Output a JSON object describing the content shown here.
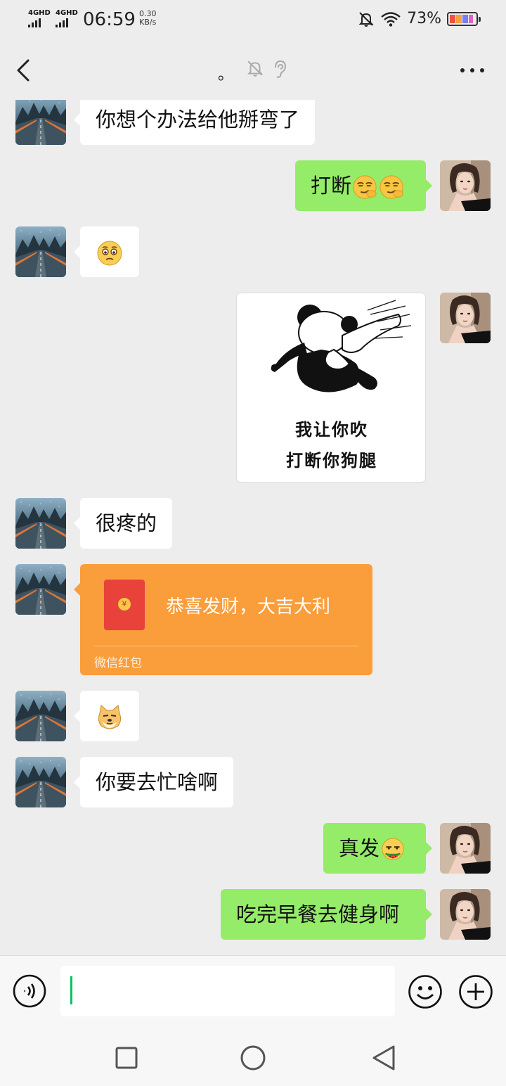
{
  "status_bar": {
    "network_1": "4GHD",
    "network_2": "4GHD",
    "time": "06:59",
    "speed_value": "0.30",
    "speed_unit": "KB/s",
    "battery": "73%",
    "icons": [
      "mute-bell-icon",
      "wifi-icon",
      "battery-icon"
    ]
  },
  "header": {
    "title": "。",
    "icons": [
      "back-arrow-icon",
      "mute-bell-icon",
      "ear-icon",
      "more-dots-icon"
    ]
  },
  "messages": [
    {
      "side": "left",
      "type": "text",
      "text": "你想个办法给他掰弯了"
    },
    {
      "side": "right",
      "type": "text",
      "text": "打断",
      "emojis": [
        "sly-smirk-emoji",
        "sly-smirk-emoji"
      ]
    },
    {
      "side": "left",
      "type": "emoji",
      "emojis": [
        "pleading-emoji"
      ]
    },
    {
      "side": "right",
      "type": "sticker",
      "lines": [
        "我让你吹",
        "打断你狗腿"
      ]
    },
    {
      "side": "left",
      "type": "text",
      "text": "很疼的"
    },
    {
      "side": "left",
      "type": "red_packet",
      "text": "恭喜发财，大吉大利",
      "footer": "微信红包"
    },
    {
      "side": "left",
      "type": "emoji",
      "emojis": [
        "doge-emoji"
      ]
    },
    {
      "side": "left",
      "type": "text",
      "text": "你要去忙啥啊"
    },
    {
      "side": "right",
      "type": "text",
      "text": "真发",
      "emojis": [
        "eat-melon-emoji"
      ]
    },
    {
      "side": "right",
      "type": "text",
      "text": "吃完早餐去健身啊"
    }
  ],
  "input": {
    "value": "",
    "icons": [
      "voice-icon",
      "emoji-smile-icon",
      "plus-icon"
    ]
  },
  "nav": {
    "icons": [
      "recent-apps-icon",
      "home-icon",
      "back-triangle-icon"
    ]
  },
  "colors": {
    "background": "#ededed",
    "bubble_self": "#95ec69",
    "bubble_other": "#ffffff",
    "red_packet": "#fa9d3b",
    "accent": "#07c160"
  }
}
